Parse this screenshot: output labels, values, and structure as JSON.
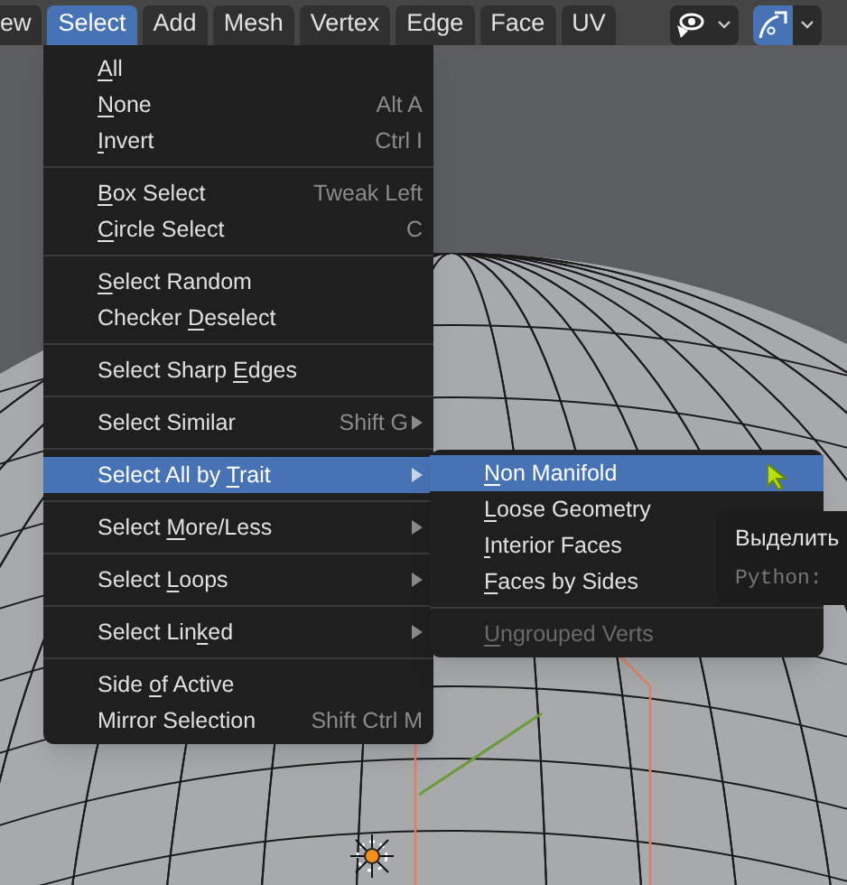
{
  "menubar": [
    {
      "label": "ew",
      "selected": false
    },
    {
      "label": "Select",
      "selected": true
    },
    {
      "label": "Add",
      "selected": false
    },
    {
      "label": "Mesh",
      "selected": false
    },
    {
      "label": "Vertex",
      "selected": false
    },
    {
      "label": "Edge",
      "selected": false
    },
    {
      "label": "Face",
      "selected": false
    },
    {
      "label": "UV",
      "selected": false
    }
  ],
  "header_tools": [
    {
      "kind": "visibility",
      "selected": false
    },
    {
      "kind": "snap",
      "selected": true
    }
  ],
  "select_menu": {
    "sections": [
      {
        "items": [
          {
            "mnemonic": "A",
            "after": "ll",
            "selected": false,
            "has_submenu": false,
            "disabled": false
          },
          {
            "mnemonic": "N",
            "after": "one",
            "shortcut": "Alt A",
            "selected": false,
            "has_submenu": false,
            "disabled": false
          },
          {
            "mnemonic": "I",
            "after": "nvert",
            "shortcut": "Ctrl I",
            "selected": false,
            "has_submenu": false,
            "disabled": false
          }
        ]
      },
      {
        "items": [
          {
            "mnemonic": "B",
            "after": "ox Select",
            "shortcut": "Tweak Left",
            "selected": false,
            "has_submenu": false,
            "disabled": false
          },
          {
            "mnemonic": "C",
            "after": "ircle Select",
            "shortcut": "C",
            "selected": false,
            "has_submenu": false,
            "disabled": false
          }
        ]
      },
      {
        "items": [
          {
            "mnemonic": "S",
            "after": "elect Random",
            "selected": false,
            "has_submenu": false,
            "disabled": false
          },
          {
            "before": "Checker ",
            "mnemonic": "D",
            "after": "eselect",
            "selected": false,
            "has_submenu": false,
            "disabled": false
          }
        ]
      },
      {
        "items": [
          {
            "before": "Select Sharp ",
            "mnemonic": "E",
            "after": "dges",
            "selected": false,
            "has_submenu": false,
            "disabled": false
          }
        ]
      },
      {
        "items": [
          {
            "before": "Select Similar",
            "shortcut": "Shift G",
            "selected": false,
            "has_submenu": true,
            "disabled": false
          }
        ]
      },
      {
        "items": [
          {
            "before": "Select All by ",
            "mnemonic": "T",
            "after": "rait",
            "selected": true,
            "has_submenu": true,
            "disabled": false
          }
        ]
      },
      {
        "items": [
          {
            "before": "Select ",
            "mnemonic": "M",
            "after": "ore/Less",
            "selected": false,
            "has_submenu": true,
            "disabled": false
          }
        ]
      },
      {
        "items": [
          {
            "before": "Select ",
            "mnemonic": "L",
            "after": "oops",
            "selected": false,
            "has_submenu": true,
            "disabled": false
          }
        ]
      },
      {
        "items": [
          {
            "before": "Select Lin",
            "mnemonic": "k",
            "after": "ed",
            "selected": false,
            "has_submenu": true,
            "disabled": false
          }
        ]
      },
      {
        "items": [
          {
            "before": "Side ",
            "mnemonic": "o",
            "after": "f Active",
            "selected": false,
            "has_submenu": false,
            "disabled": false
          },
          {
            "before": "Mirror Selection",
            "shortcut": "Shift Ctrl M",
            "selected": false,
            "has_submenu": false,
            "disabled": false
          }
        ]
      }
    ]
  },
  "trait_submenu": {
    "sections": [
      {
        "items": [
          {
            "mnemonic": "N",
            "after": "on Manifold",
            "selected": true,
            "disabled": false
          },
          {
            "mnemonic": "L",
            "after": "oose Geometry",
            "selected": false,
            "disabled": false
          },
          {
            "mnemonic": "I",
            "after": "nterior Faces",
            "selected": false,
            "disabled": false
          },
          {
            "mnemonic": "F",
            "after": "aces by Sides",
            "selected": false,
            "disabled": false
          }
        ]
      },
      {
        "items": [
          {
            "mnemonic": "U",
            "after": "ngrouped Verts",
            "selected": false,
            "disabled": true
          }
        ]
      }
    ]
  },
  "tooltip": {
    "title": "Выделить",
    "python": "Python:"
  }
}
